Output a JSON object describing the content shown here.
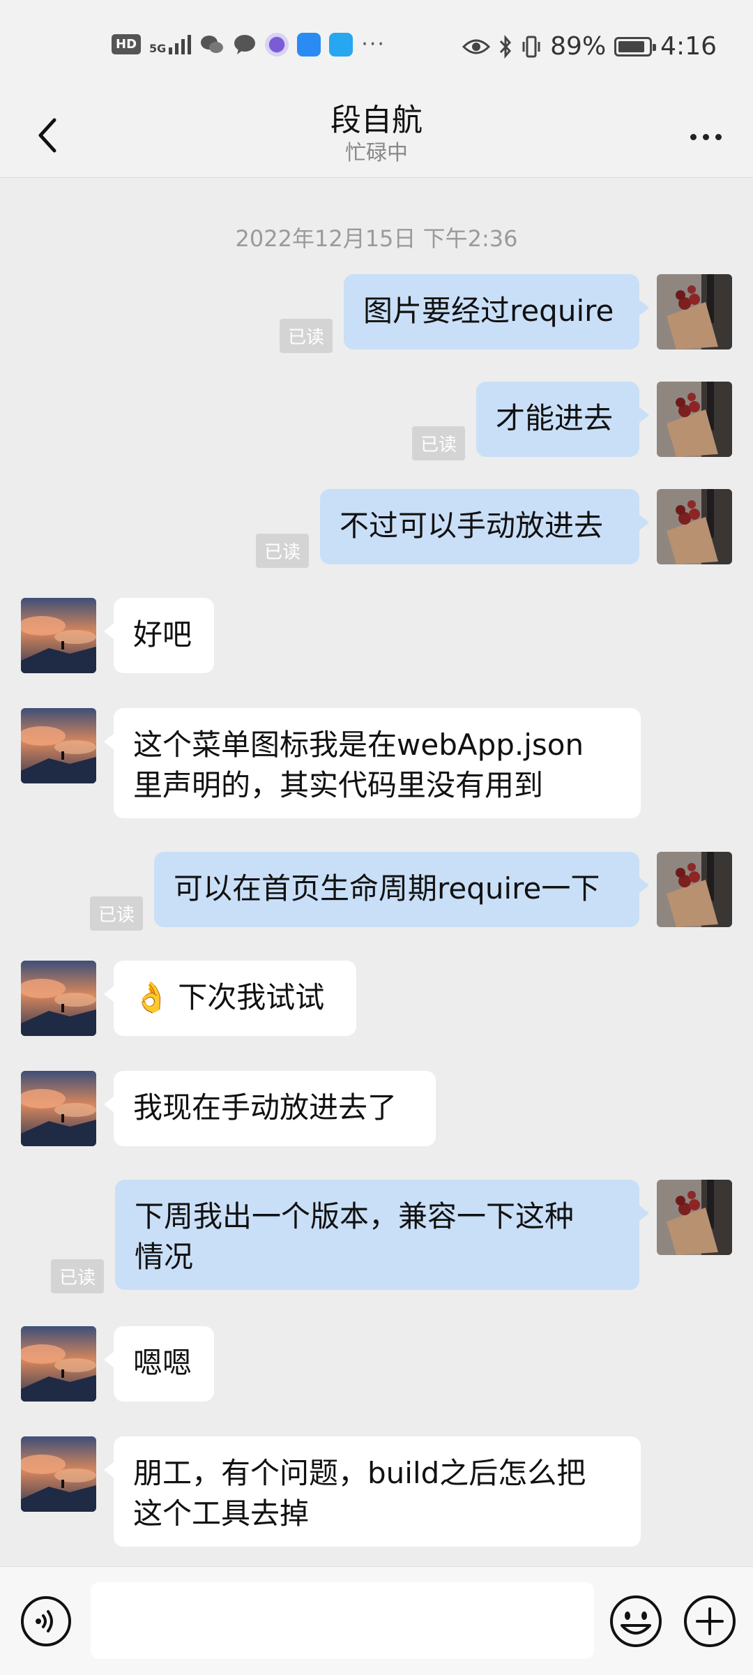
{
  "status_bar": {
    "hd": "HD",
    "network": "5G",
    "dots": "···",
    "battery_pct": "89%",
    "time": "4:16",
    "battery_level": 0.89
  },
  "header": {
    "title": "段自航",
    "subtitle": "忙碌中"
  },
  "chat": {
    "timestamp": "2022年12月15日 下午2:36",
    "read_label": "已读",
    "messages": [
      {
        "dir": "out",
        "lines": [
          "图片要经过require"
        ]
      },
      {
        "dir": "out",
        "lines": [
          "才能进去"
        ]
      },
      {
        "dir": "out",
        "lines": [
          "不过可以手动放进去"
        ]
      },
      {
        "dir": "in",
        "lines": [
          "好吧"
        ]
      },
      {
        "dir": "in",
        "lines": [
          "这个菜单图标我是在webApp.json",
          "里声明的，其实代码里没有用到"
        ]
      },
      {
        "dir": "out",
        "lines": [
          "可以在首页生命周期require一下"
        ]
      },
      {
        "dir": "in",
        "lines": [
          "下次我试试"
        ],
        "emoji": "👌"
      },
      {
        "dir": "in",
        "lines": [
          "我现在手动放进去了"
        ]
      },
      {
        "dir": "out",
        "lines": [
          "下周我出一个版本，兼容一下这种",
          "情况"
        ]
      },
      {
        "dir": "in",
        "lines": [
          "嗯嗯"
        ]
      },
      {
        "dir": "in",
        "lines": [
          "朋工，有个问题，build之后怎么把",
          "这个工具去掉"
        ]
      }
    ]
  },
  "colors": {
    "background": "#ededed",
    "outgoing_bubble": "#c9dff7",
    "incoming_bubble": "#ffffff",
    "read_badge": "#d4d4d4"
  },
  "icons": {
    "back": "chevron-left-icon",
    "more": "more-dots-icon",
    "voice": "voice-icon",
    "emoji": "emoji-icon",
    "plus": "plus-icon"
  }
}
